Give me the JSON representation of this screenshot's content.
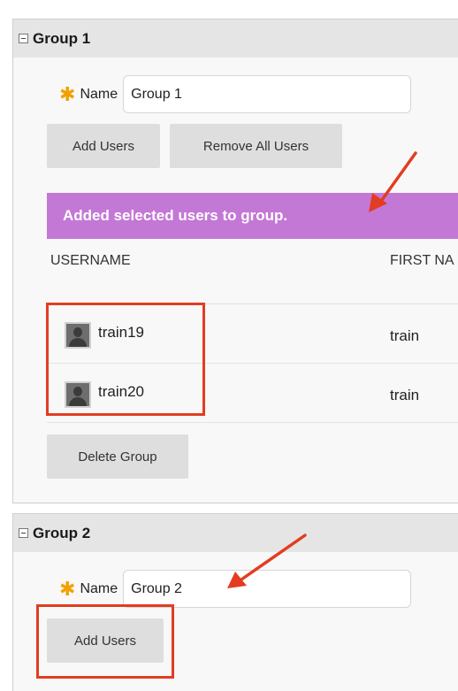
{
  "groups": [
    {
      "title": "Group 1",
      "name_label": "Name",
      "name_value": "Group 1",
      "buttons": {
        "add_users": "Add Users",
        "remove_all_users": "Remove All Users",
        "delete_group": "Delete Group"
      },
      "banner": "Added selected users to group.",
      "columns": [
        "USERNAME",
        "FIRST NA"
      ],
      "users": [
        {
          "username": "train19",
          "first_name": "train"
        },
        {
          "username": "train20",
          "first_name": "train"
        }
      ]
    },
    {
      "title": "Group 2",
      "name_label": "Name",
      "name_value": "Group 2",
      "buttons": {
        "add_users": "Add Users"
      }
    }
  ],
  "colors": {
    "banner_bg": "#c378d5",
    "required_star": "#f2a100",
    "annotation_red": "#e23d22",
    "header_bg": "#e5e5e5"
  },
  "icons": [
    "collapse-icon",
    "required-star-icon",
    "user-avatar-icon",
    "annotation-arrow-icon"
  ]
}
